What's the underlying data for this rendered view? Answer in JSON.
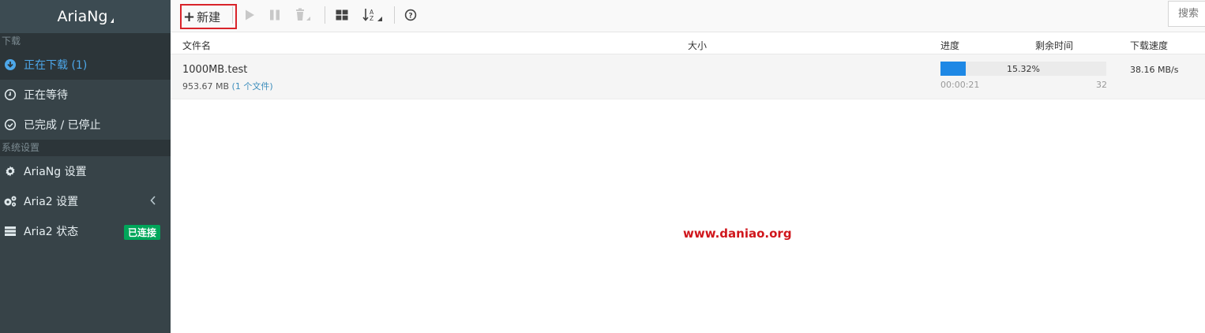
{
  "sidebar": {
    "brand": "AriaNg",
    "download_section": "下载",
    "items": [
      {
        "label": "正在下载 (1)",
        "icon": "download-circle-icon"
      },
      {
        "label": "正在等待",
        "icon": "clock-icon"
      },
      {
        "label": "已完成 / 已停止",
        "icon": "check-circle-icon"
      }
    ],
    "settings_section": "系统设置",
    "settings_items": [
      {
        "label": "AriaNg 设置",
        "icon": "gear-icon"
      },
      {
        "label": "Aria2 设置",
        "icon": "gears-icon"
      },
      {
        "label": "Aria2 状态",
        "icon": "server-icon",
        "badge": "已连接"
      }
    ]
  },
  "toolbar": {
    "new_label": "新建",
    "search_placeholder": "搜索"
  },
  "table": {
    "headers": {
      "name": "文件名",
      "size": "大小",
      "progress": "进度",
      "remaining": "剩余时间",
      "speed": "下载速度"
    }
  },
  "task": {
    "name": "1000MB.test",
    "size": "953.67 MB",
    "files": "(1 个文件)",
    "progress_percent": "15.32%",
    "progress_value": 15.32,
    "remaining_time": "00:00:21",
    "connections": "32",
    "speed": "38.16 MB/s"
  },
  "watermark": "www.daniao.org",
  "colors": {
    "accent": "#4da7e9",
    "progress": "#1e88e5",
    "badge": "#00a65a",
    "highlight_border": "#d9232a",
    "watermark": "#d0161c"
  }
}
